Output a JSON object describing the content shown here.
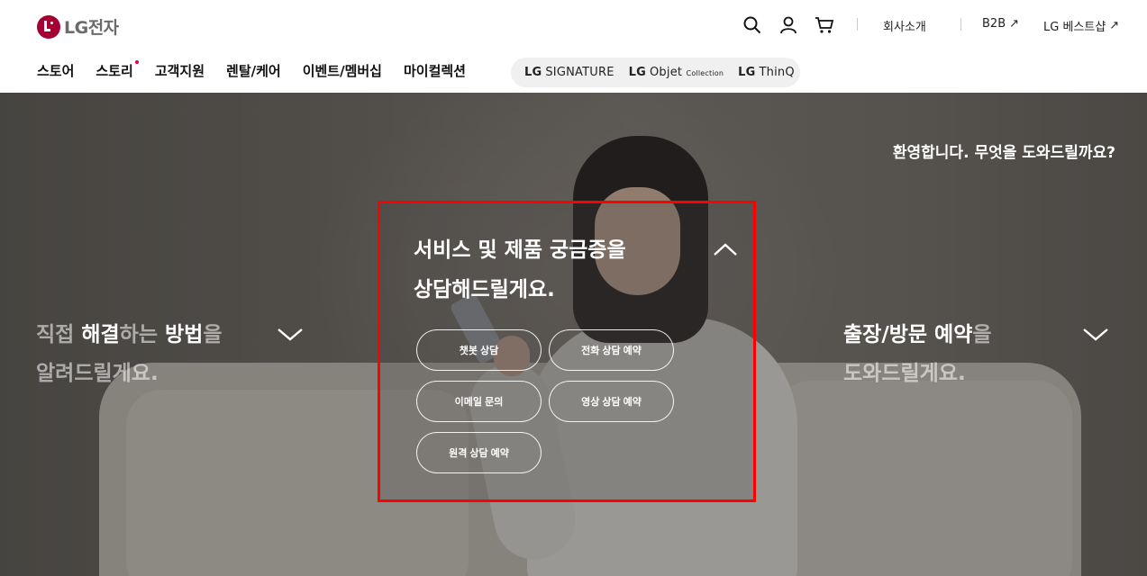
{
  "header": {
    "logo_text": "LG전자",
    "icons": [
      "search-icon",
      "user-icon",
      "cart-icon"
    ],
    "util_links": [
      {
        "label": "회사소개",
        "arrow": false
      },
      {
        "label": "B2B",
        "arrow": true
      },
      {
        "label": "LG 베스트샵",
        "arrow": true
      }
    ],
    "arrow_glyph": "↗",
    "nav": [
      {
        "label": "스토어"
      },
      {
        "label": "스토리",
        "new": true
      },
      {
        "label": "고객지원"
      },
      {
        "label": "렌탈/케어"
      },
      {
        "label": "이벤트/멤버십"
      },
      {
        "label": "마이컬렉션"
      }
    ],
    "brands": [
      {
        "lg": "LG",
        "name": "SIGNATURE",
        "sub": ""
      },
      {
        "lg": "LG",
        "name": "Objet",
        "sub": "Collection"
      },
      {
        "lg": "LG",
        "name": "ThinQ",
        "sub": ""
      }
    ],
    "accent_color": "#a50034"
  },
  "hero": {
    "welcome": "환영합니다. 무엇을 도와드릴까요?",
    "left": {
      "line1_dim1": "직접 ",
      "line1_hl1": "해결",
      "line1_dim2": "하는 ",
      "line1_hl2": "방법",
      "line1_dim3": "을",
      "line2": "알려드릴게요."
    },
    "center": {
      "line1": "서비스 및 제품 궁금증을",
      "line2": "상담해드릴게요.",
      "buttons": [
        "챗봇 상담",
        "전화 상담 예약",
        "이메일 문의",
        "영상 상담 예약",
        "원격 상담 예약"
      ]
    },
    "right": {
      "line1_hl": "출장/방문 예약",
      "line1_dim": "을",
      "line2": "도와드릴게요."
    },
    "highlight_border_color": "#ff0000"
  }
}
